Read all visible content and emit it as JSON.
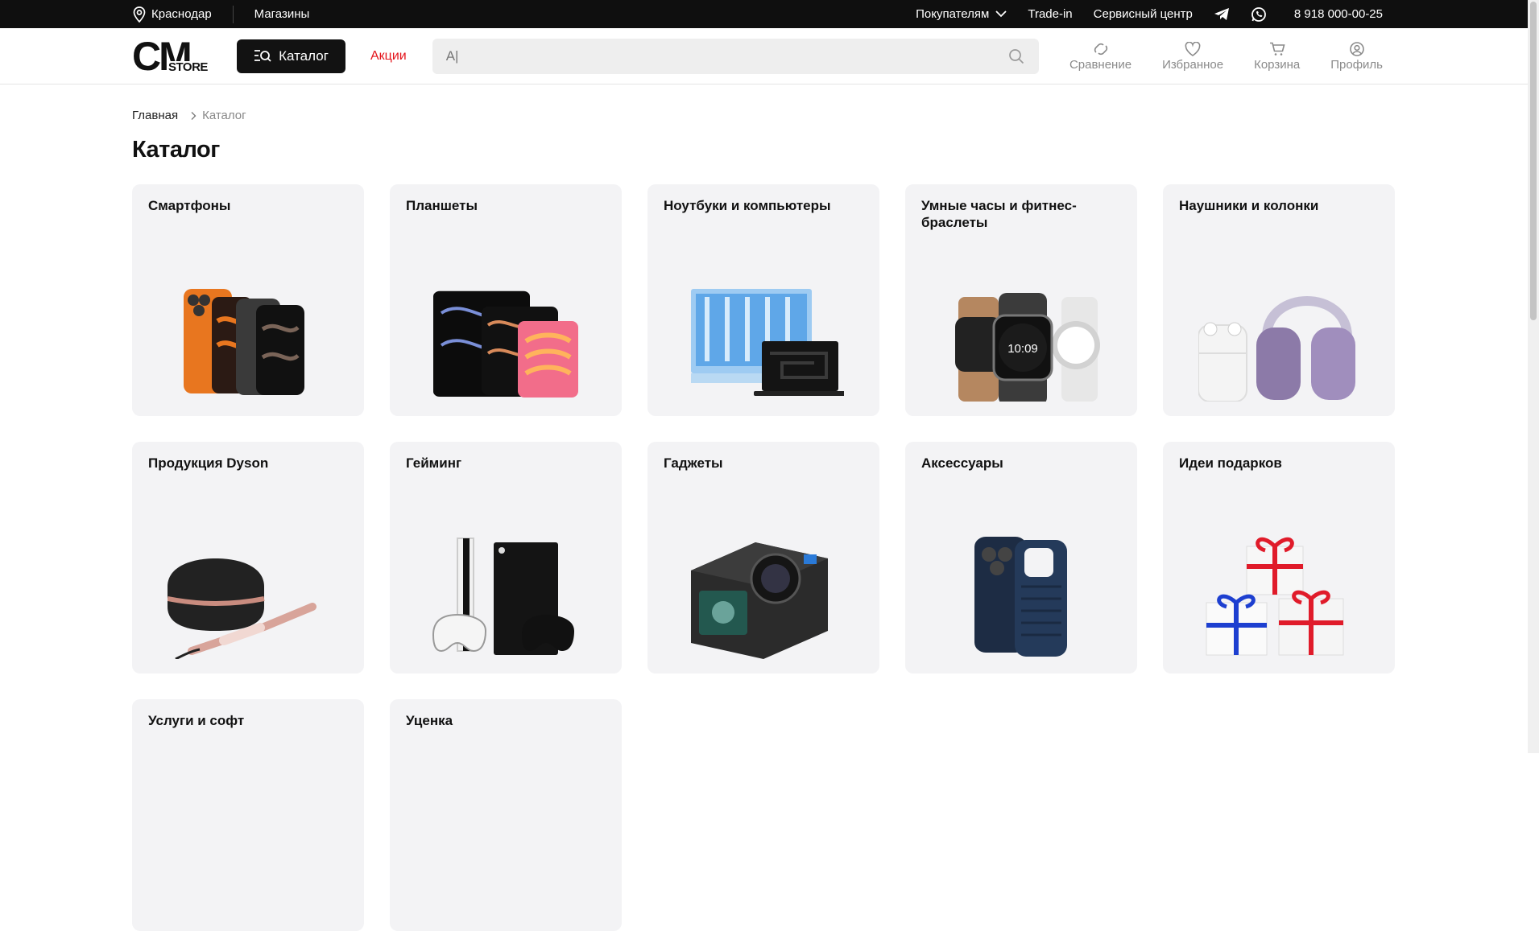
{
  "topbar": {
    "city": "Краснодар",
    "stores": "Магазины",
    "buyers": "Покупателям",
    "tradein": "Trade-in",
    "service": "Сервисный центр",
    "phone": "8 918 000-00-25"
  },
  "header": {
    "logo_main": "CM",
    "logo_sub": "STORE",
    "catalog_label": "Каталог",
    "promo_label": "Акции",
    "search_value": "А|",
    "compare": "Сравнение",
    "favorites": "Избранное",
    "cart": "Корзина",
    "profile": "Профиль"
  },
  "breadcrumb": {
    "home": "Главная",
    "current": "Каталог"
  },
  "page_title": "Каталог",
  "categories": [
    {
      "title": "Смартфоны",
      "icon": "smartphones-image"
    },
    {
      "title": "Планшеты",
      "icon": "tablets-image"
    },
    {
      "title": "Ноутбуки и компьютеры",
      "icon": "laptops-image"
    },
    {
      "title": "Умные часы и фитнес-браслеты",
      "icon": "smartwatches-image"
    },
    {
      "title": "Наушники и колонки",
      "icon": "headphones-image"
    },
    {
      "title": "Продукция Dyson",
      "icon": "dyson-image"
    },
    {
      "title": "Гейминг",
      "icon": "gaming-image"
    },
    {
      "title": "Гаджеты",
      "icon": "gadgets-image"
    },
    {
      "title": "Аксессуары",
      "icon": "accessories-image"
    },
    {
      "title": "Идеи подарков",
      "icon": "gifts-image"
    },
    {
      "title": "Услуги и софт",
      "icon": "services-image"
    },
    {
      "title": "Уценка",
      "icon": "discount-image"
    }
  ],
  "colors": {
    "accent": "#e4141b",
    "dark": "#121212",
    "card_bg": "#f3f3f5"
  }
}
